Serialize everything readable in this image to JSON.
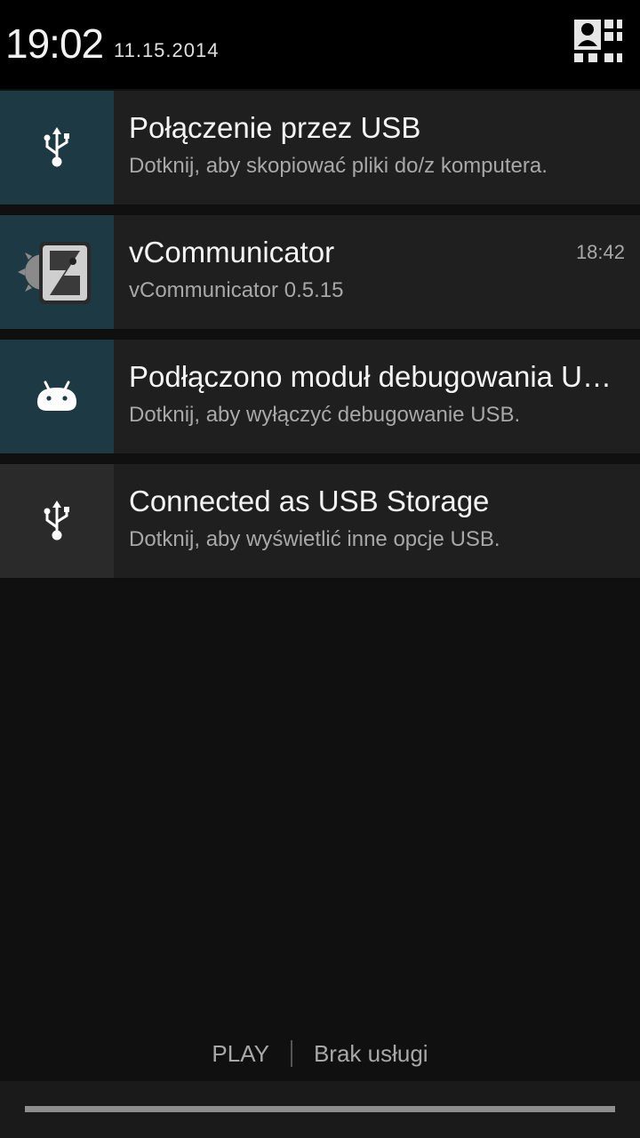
{
  "status_bar": {
    "time": "19:02",
    "date": "11.15.2014",
    "settings_icon": "quick-settings-icon"
  },
  "notifications": [
    {
      "title": "Połączenie przez USB",
      "subtitle": "Dotknij, aby skopiować pliki do/z komputera.",
      "icon": "usb-icon",
      "time": ""
    },
    {
      "title": "vCommunicator",
      "subtitle": "vCommunicator 0.5.15",
      "icon": "vcommunicator-app-icon",
      "time": "18:42"
    },
    {
      "title": "Podłączono moduł debugowania USB",
      "subtitle": "Dotknij, aby wyłączyć debugowanie USB.",
      "icon": "android-debug-icon",
      "time": ""
    },
    {
      "title": "Connected as USB Storage",
      "subtitle": "Dotknij, aby wyświetlić inne opcje USB.",
      "icon": "usb-icon",
      "time": ""
    }
  ],
  "carrier": {
    "sim1": "PLAY",
    "sim2": "Brak usługi"
  },
  "colors": {
    "icon_background": "#1d3944",
    "notification_background": "#1f1f1f",
    "panel_background": "#101010"
  }
}
